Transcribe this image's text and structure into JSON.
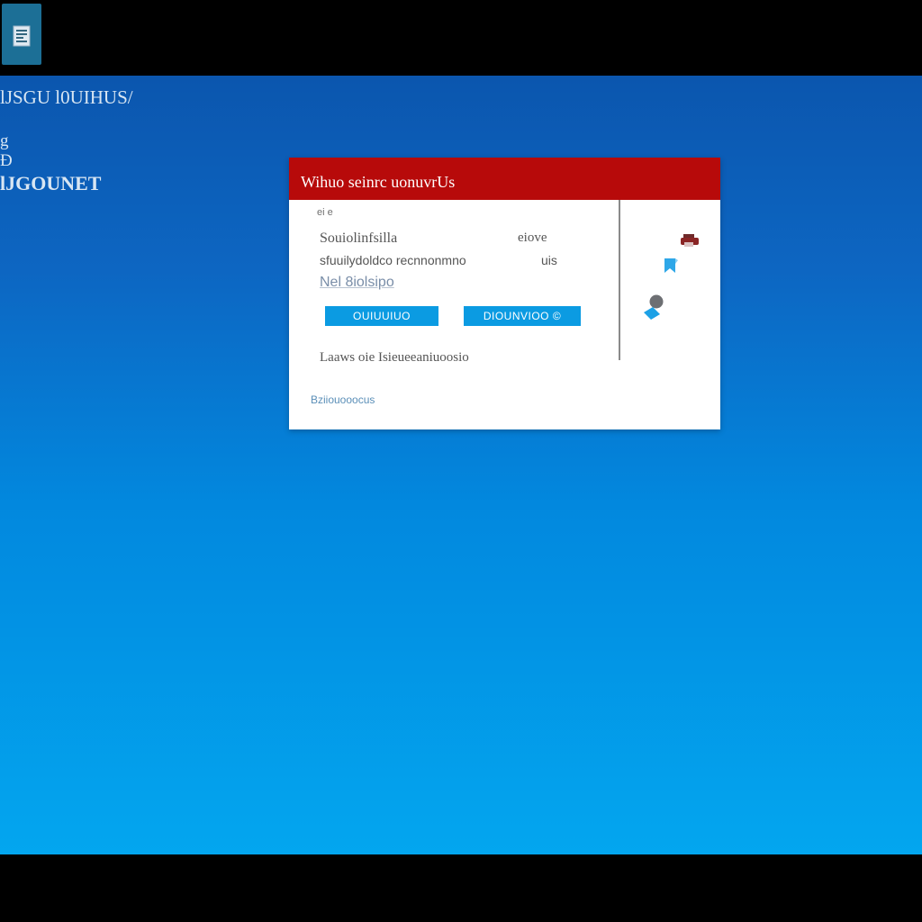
{
  "desktop": {
    "app_tile_icon": "document-app-icon",
    "texts": [
      "lJSGU l0UIHUS/",
      "g",
      "Ð",
      "lJGOUNET"
    ]
  },
  "dialog": {
    "title": "Wihuo seinrc uonuvrUs",
    "small_label": "ei e",
    "row_title": "Souiolinfsilla",
    "row_right": "eiove",
    "row_desc": "sfuuilydoldco recnnonmno",
    "row_desc2": "uis",
    "link_text": "Nel 8iolsipo",
    "button_primary": "OUIUUIUO",
    "button_secondary": "DIOUNVIOO ©",
    "footer_note": "Laaws oie Isieueeaniuoosio",
    "footer_link": "Bziiouooocus",
    "colors": {
      "header": "#b70a0a",
      "button": "#0b9be2"
    },
    "side_icons": [
      "printer-icon",
      "bookmark-icon",
      "user-icon"
    ]
  }
}
